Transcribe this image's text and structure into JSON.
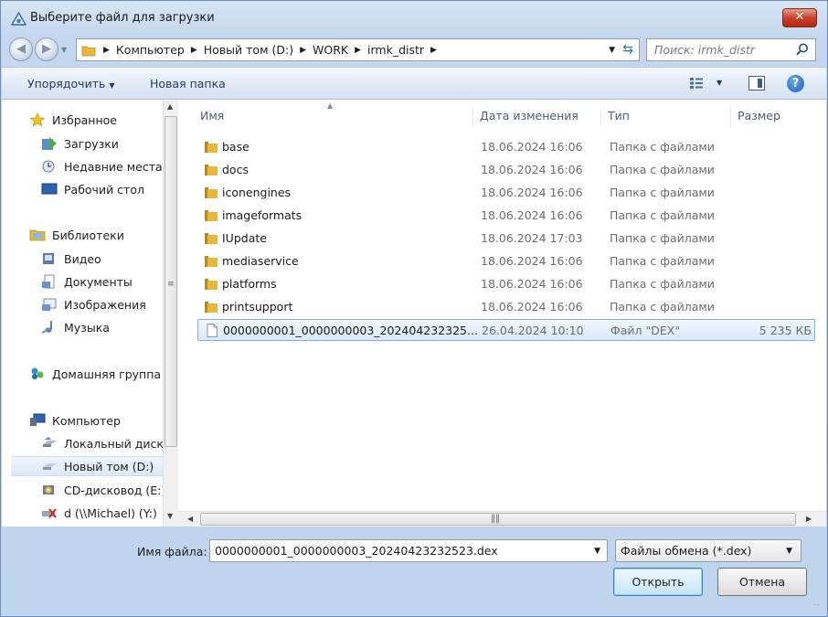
{
  "window": {
    "title": "Выберите файл для загрузки",
    "close_label": "✕"
  },
  "address": {
    "crumbs": [
      "Компьютер",
      "Новый том (D:)",
      "WORK",
      "irmk_distr"
    ]
  },
  "search": {
    "placeholder": "Поиск: irmk_distr"
  },
  "toolbar": {
    "organize_label": "Упорядочить",
    "new_folder_label": "Новая папка",
    "help_label": "?"
  },
  "nav": {
    "items": [
      {
        "label": "Избранное",
        "icon": "star-icon"
      },
      {
        "label": "Загрузки",
        "icon": "downloads-icon"
      },
      {
        "label": "Недавние места",
        "icon": "recent-places-icon"
      },
      {
        "label": "Рабочий стол",
        "icon": "desktop-icon"
      },
      {
        "label": "Библиотеки",
        "icon": "libraries-icon"
      },
      {
        "label": "Видео",
        "icon": "video-icon"
      },
      {
        "label": "Документы",
        "icon": "documents-icon"
      },
      {
        "label": "Изображения",
        "icon": "pictures-icon"
      },
      {
        "label": "Музыка",
        "icon": "music-icon"
      },
      {
        "label": "Домашняя группа",
        "icon": "homegroup-icon"
      },
      {
        "label": "Компьютер",
        "icon": "computer-icon"
      },
      {
        "label": "Локальный диск",
        "icon": "local-disk-icon"
      },
      {
        "label": "Новый том (D:)",
        "icon": "drive-icon",
        "selected": true
      },
      {
        "label": "CD-дисковод (E:)",
        "icon": "cd-drive-icon"
      },
      {
        "label": "d (\\\\Michael) (Y:)",
        "icon": "network-drive-disconnected-icon"
      }
    ]
  },
  "columns": {
    "name": "Имя",
    "date": "Дата изменения",
    "type": "Тип",
    "size": "Размер"
  },
  "files": [
    {
      "name": "base",
      "date": "18.06.2024 16:06",
      "type": "Папка с файлами",
      "size": "",
      "kind": "folder"
    },
    {
      "name": "docs",
      "date": "18.06.2024 16:06",
      "type": "Папка с файлами",
      "size": "",
      "kind": "folder"
    },
    {
      "name": "iconengines",
      "date": "18.06.2024 16:06",
      "type": "Папка с файлами",
      "size": "",
      "kind": "folder"
    },
    {
      "name": "imageformats",
      "date": "18.06.2024 16:06",
      "type": "Папка с файлами",
      "size": "",
      "kind": "folder"
    },
    {
      "name": "IUpdate",
      "date": "18.06.2024 17:03",
      "type": "Папка с файлами",
      "size": "",
      "kind": "folder"
    },
    {
      "name": "mediaservice",
      "date": "18.06.2024 16:06",
      "type": "Папка с файлами",
      "size": "",
      "kind": "folder"
    },
    {
      "name": "platforms",
      "date": "18.06.2024 16:06",
      "type": "Папка с файлами",
      "size": "",
      "kind": "folder"
    },
    {
      "name": "printsupport",
      "date": "18.06.2024 16:06",
      "type": "Папка с файлами",
      "size": "",
      "kind": "folder"
    },
    {
      "name": "0000000001_0000000003_202404232325...",
      "date": "26.04.2024 10:10",
      "type": "Файл \"DEX\"",
      "size": "5 235 КБ",
      "kind": "file",
      "selected": true
    }
  ],
  "bottom": {
    "filename_label": "Имя файла:",
    "filename_value": "0000000001_0000000003_20240423232523.dex",
    "filetype_value": "Файлы обмена (*.dex)",
    "open_label": "Открыть",
    "cancel_label": "Отмена"
  },
  "colors": {
    "accent": "#3c7fb1",
    "folder": "#e8b83e",
    "selection": "#d9e8fb"
  }
}
